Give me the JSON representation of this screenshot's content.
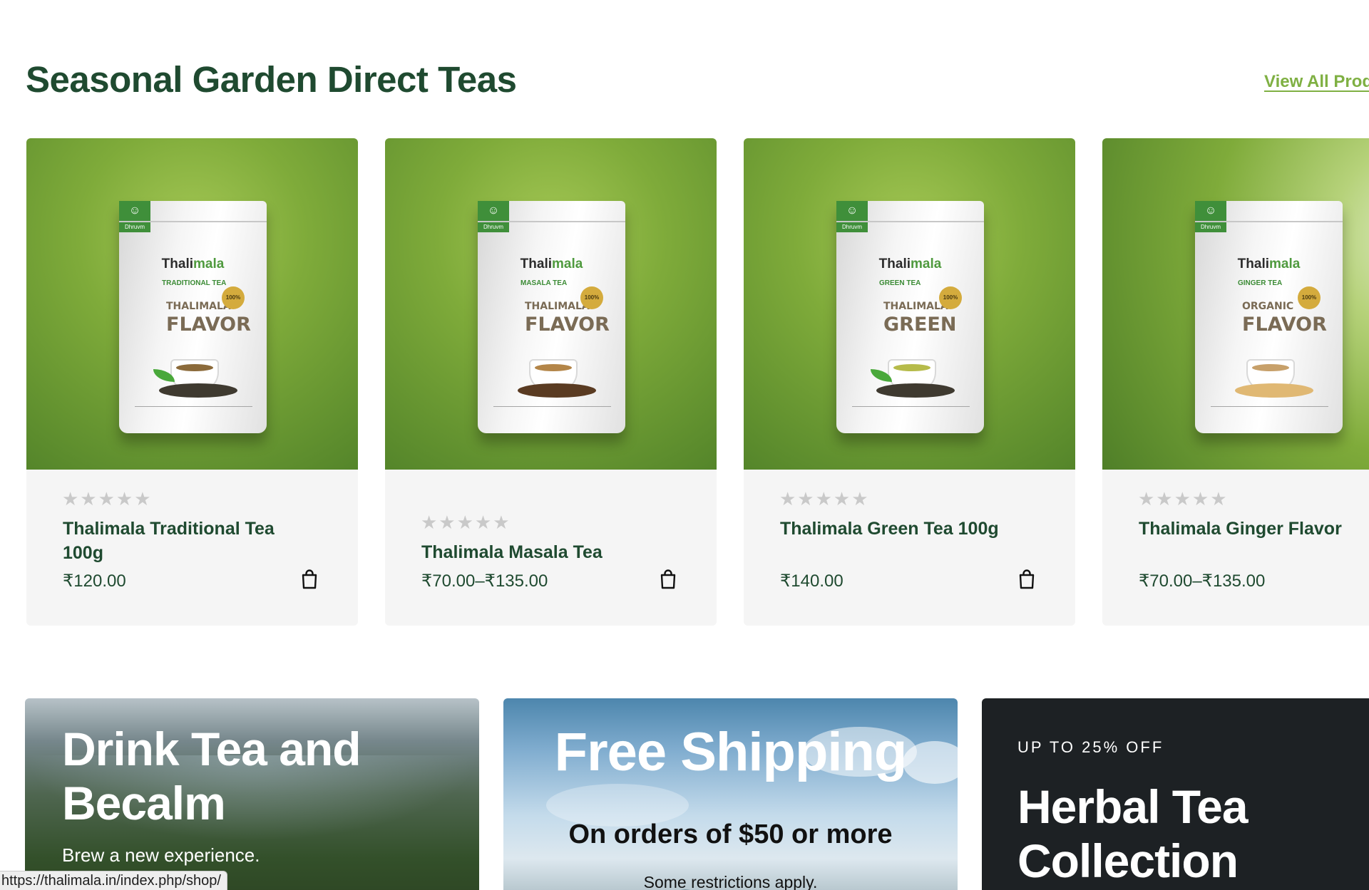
{
  "section": {
    "title": "Seasonal Garden Direct Teas",
    "view_all_label": "View All Prod"
  },
  "products": [
    {
      "name": "Thalimala Traditional Tea 100g",
      "price": "₹120.00",
      "stars": "★★★★★",
      "rating": 0,
      "pouch": {
        "brand_a": "Thali",
        "brand_b": "mala",
        "variant": "TRADITIONAL TEA",
        "line1": "THALIMALA",
        "line2": "FLAVOR",
        "seal": "100%"
      }
    },
    {
      "name": "Thalimala Masala Tea",
      "price": "₹70.00–₹135.00",
      "stars": "★★★★★",
      "rating": 0,
      "pouch": {
        "brand_a": "Thali",
        "brand_b": "mala",
        "variant": "MASALA TEA",
        "line1": "THALIMALA",
        "line2": "FLAVOR",
        "seal": "100%"
      }
    },
    {
      "name": "Thalimala Green Tea 100g",
      "price": "₹140.00",
      "stars": "★★★★★",
      "rating": 0,
      "pouch": {
        "brand_a": "Thali",
        "brand_b": "mala",
        "variant": "GREEN TEA",
        "line1": "THALIMALA",
        "line2": "GREEN",
        "seal": "100%"
      }
    },
    {
      "name": "Thalimala Ginger Flavor",
      "price": "₹70.00–₹135.00",
      "stars": "★★★★★",
      "rating": 0,
      "pouch": {
        "brand_a": "Thali",
        "brand_b": "mala",
        "variant": "GINGER TEA",
        "line1": "ORGANIC",
        "line2": "FLAVOR",
        "seal": "100%"
      }
    }
  ],
  "promos": {
    "drink_tea": {
      "title": "Drink Tea and Becalm",
      "subtitle": "Brew a new experience."
    },
    "free_shipping": {
      "title": "Free Shipping",
      "subtitle": "On orders of $50 or more",
      "note": "Some restrictions apply."
    },
    "herbal": {
      "eyebrow": "UP TO 25% OFF",
      "title": "Herbal Tea Collection"
    }
  },
  "status_bar": {
    "url": "https://thalimala.in/index.php/shop/"
  },
  "icons": {
    "cart": "shopping-bag-icon",
    "star": "star-icon"
  },
  "colors": {
    "heading_green": "#1f4a30",
    "link_green": "#7fb043",
    "card_bg": "#f5f5f5",
    "star_gray": "#c9c9c9"
  }
}
